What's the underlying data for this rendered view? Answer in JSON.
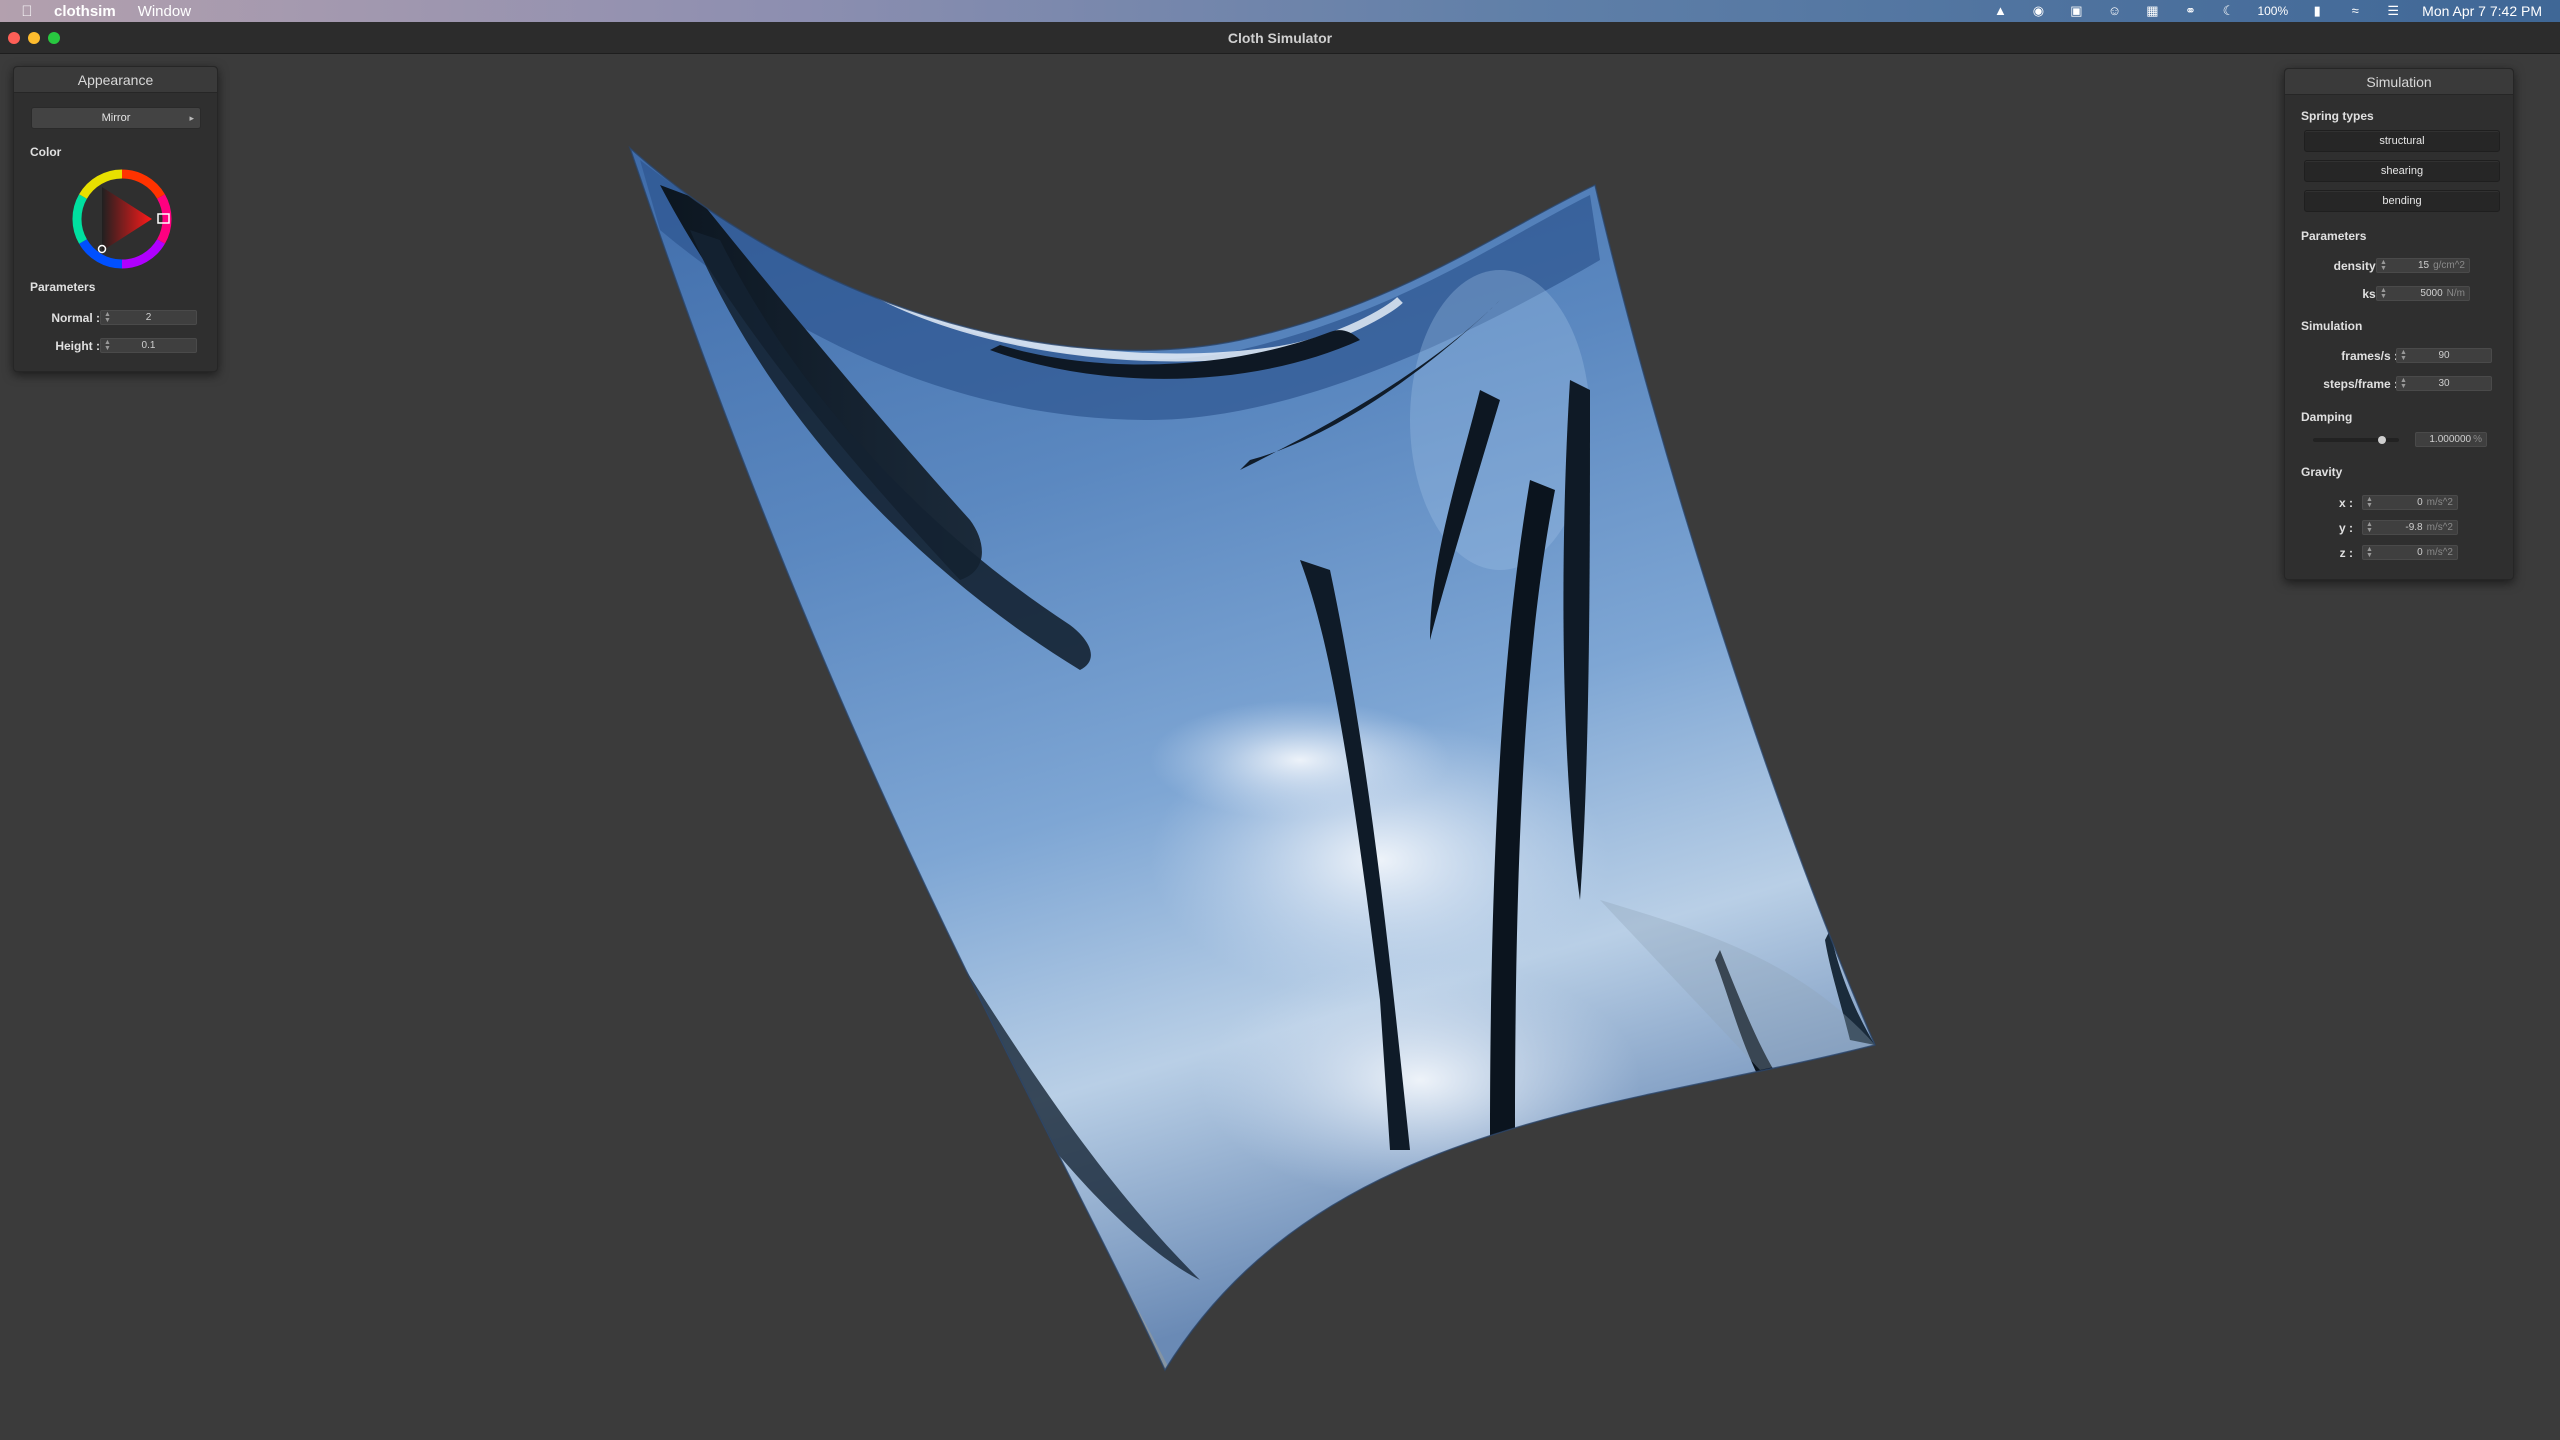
{
  "menubar": {
    "app_name": "clothsim",
    "menus": [
      "Window"
    ],
    "battery": "100%",
    "datetime": "Mon Apr 7  7:42 PM",
    "status_icons": [
      "vlc-icon",
      "shield-icon",
      "screenshot-icon",
      "smiley-icon",
      "grid-icon",
      "headphones-icon",
      "moon-icon",
      "battery-icon",
      "wifi-icon",
      "control-center-icon"
    ]
  },
  "window": {
    "title": "Cloth Simulator"
  },
  "appearance": {
    "title": "Appearance",
    "shader": "Mirror",
    "color_label": "Color",
    "parameters_label": "Parameters",
    "normal_label": "Normal :",
    "normal_value": "2",
    "height_label": "Height :",
    "height_value": "0.1",
    "selected_color": "#ff2020"
  },
  "simulation": {
    "title": "Simulation",
    "spring_types_label": "Spring types",
    "spring_types": [
      "structural",
      "shearing",
      "bending"
    ],
    "parameters_label": "Parameters",
    "density_label": "density :",
    "density_value": "15",
    "density_unit": "g/cm^2",
    "ks_label": "ks :",
    "ks_value": "5000",
    "ks_unit": "N/m",
    "simulation_label": "Simulation",
    "fps_label": "frames/s :",
    "fps_value": "90",
    "steps_label": "steps/frame :",
    "steps_value": "30",
    "damping_label": "Damping",
    "damping_value": "1.000000",
    "damping_unit": "%",
    "damping_level": 0.8,
    "gravity_label": "Gravity",
    "gx_label": "x :",
    "gx_value": "0",
    "gy_label": "y :",
    "gy_value": "-9.8",
    "gz_label": "z :",
    "gz_value": "0",
    "gravity_unit": "m/s^2"
  }
}
